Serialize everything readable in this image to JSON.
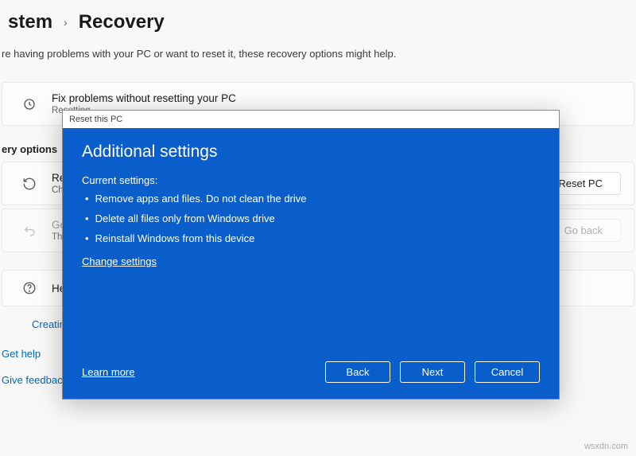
{
  "breadcrumb": {
    "parent_fragment": "stem",
    "current": "Recovery"
  },
  "subtitle_fragment": "re having problems with your PC or want to reset it, these recovery options might help.",
  "cards": {
    "fix": {
      "title": "Fix problems without resetting your PC",
      "sub": "Resetting"
    },
    "reset": {
      "title": "Reset th",
      "sub": "Choose to",
      "action": "Reset PC"
    },
    "goback": {
      "title": "Go back",
      "sub": "This optio",
      "action": "Go back"
    },
    "help": {
      "title": "Help wit"
    }
  },
  "section_label": "ery options",
  "links": {
    "creating": "Creating",
    "get_help": "Get help",
    "give_feedback": "Give feedback"
  },
  "modal": {
    "titlebar": "Reset this PC",
    "heading": "Additional settings",
    "subheading": "Current settings:",
    "bullets": [
      "Remove apps and files. Do not clean the drive",
      "Delete all files only from Windows drive",
      "Reinstall Windows from this device"
    ],
    "change": "Change settings",
    "learn": "Learn more",
    "buttons": {
      "back": "Back",
      "next": "Next",
      "cancel": "Cancel"
    }
  },
  "watermark": "wsxdn.com"
}
